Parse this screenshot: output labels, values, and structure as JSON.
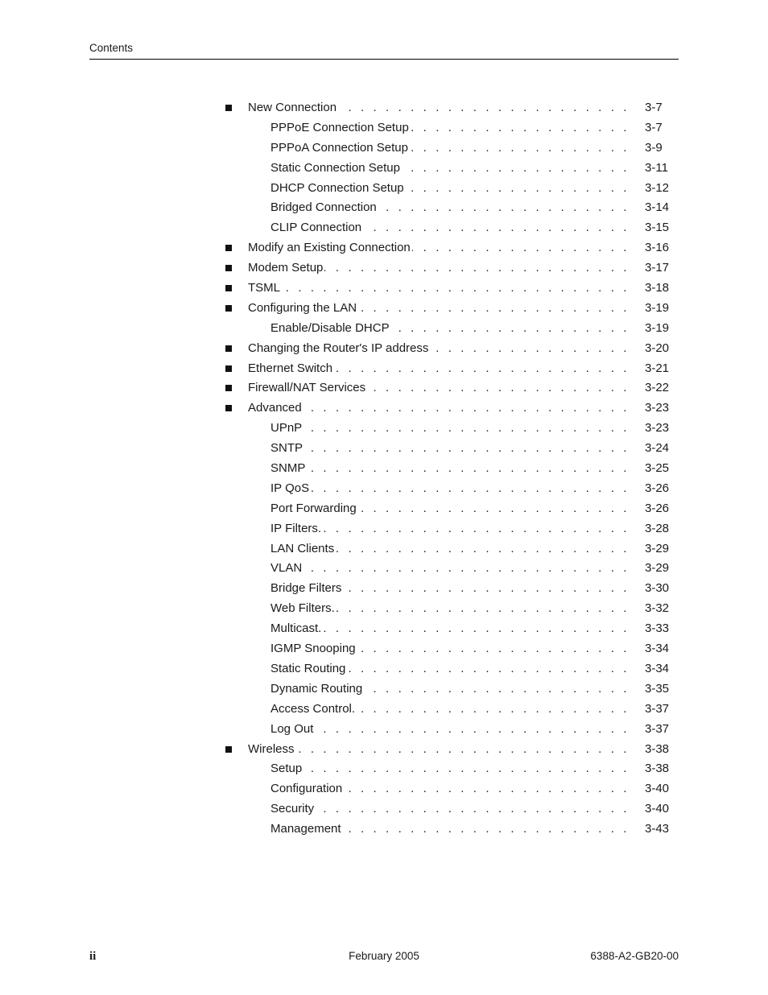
{
  "header": {
    "title": "Contents"
  },
  "toc": {
    "leader": ". . . . . . . . . . . . . . . . . . . . . . . . . . . . . . . . . . . . . . . . . . . . . . . . . . . . . . . . .",
    "entries": [
      {
        "level": 1,
        "label": "New Connection",
        "page": "3-7"
      },
      {
        "level": 2,
        "label": "PPPoE Connection Setup",
        "page": "3-7"
      },
      {
        "level": 2,
        "label": "PPPoA Connection Setup",
        "page": "3-9"
      },
      {
        "level": 2,
        "label": "Static Connection Setup",
        "page": "3-11"
      },
      {
        "level": 2,
        "label": "DHCP Connection Setup",
        "page": "3-12"
      },
      {
        "level": 2,
        "label": "Bridged Connection",
        "page": "3-14"
      },
      {
        "level": 2,
        "label": "CLIP Connection",
        "page": "3-15"
      },
      {
        "level": 1,
        "label": "Modify an Existing Connection",
        "page": "3-16"
      },
      {
        "level": 1,
        "label": "Modem Setup",
        "page": "3-17"
      },
      {
        "level": 1,
        "label": "TSML",
        "page": "3-18"
      },
      {
        "level": 1,
        "label": "Configuring the LAN",
        "page": "3-19"
      },
      {
        "level": 2,
        "label": "Enable/Disable DHCP",
        "page": "3-19"
      },
      {
        "level": 1,
        "label": "Changing the Router's IP address",
        "page": "3-20"
      },
      {
        "level": 1,
        "label": "Ethernet Switch",
        "page": "3-21"
      },
      {
        "level": 1,
        "label": "Firewall/NAT Services",
        "page": "3-22"
      },
      {
        "level": 1,
        "label": "Advanced",
        "page": "3-23"
      },
      {
        "level": 2,
        "label": "UPnP",
        "page": "3-23"
      },
      {
        "level": 2,
        "label": "SNTP",
        "page": "3-24"
      },
      {
        "level": 2,
        "label": "SNMP",
        "page": "3-25"
      },
      {
        "level": 2,
        "label": "IP QoS",
        "page": "3-26"
      },
      {
        "level": 2,
        "label": "Port Forwarding",
        "page": "3-26"
      },
      {
        "level": 2,
        "label": "IP Filters.",
        "page": "3-28"
      },
      {
        "level": 2,
        "label": "LAN Clients",
        "page": "3-29"
      },
      {
        "level": 2,
        "label": "VLAN",
        "page": "3-29"
      },
      {
        "level": 2,
        "label": "Bridge Filters",
        "page": "3-30"
      },
      {
        "level": 2,
        "label": "Web Filters.",
        "page": "3-32"
      },
      {
        "level": 2,
        "label": "Multicast.",
        "page": "3-33"
      },
      {
        "level": 2,
        "label": "IGMP Snooping",
        "page": "3-34"
      },
      {
        "level": 2,
        "label": "Static Routing",
        "page": "3-34"
      },
      {
        "level": 2,
        "label": "Dynamic Routing",
        "page": "3-35"
      },
      {
        "level": 2,
        "label": "Access Control.",
        "page": "3-37"
      },
      {
        "level": 2,
        "label": "Log Out",
        "page": "3-37"
      },
      {
        "level": 1,
        "label": "Wireless",
        "page": "3-38"
      },
      {
        "level": 2,
        "label": "Setup",
        "page": "3-38"
      },
      {
        "level": 2,
        "label": "Configuration",
        "page": "3-40"
      },
      {
        "level": 2,
        "label": "Security",
        "page": "3-40"
      },
      {
        "level": 2,
        "label": "Management",
        "page": "3-43"
      }
    ]
  },
  "footer": {
    "page_number": "ii",
    "date": "February 2005",
    "doc_number": "6388-A2-GB20-00"
  }
}
